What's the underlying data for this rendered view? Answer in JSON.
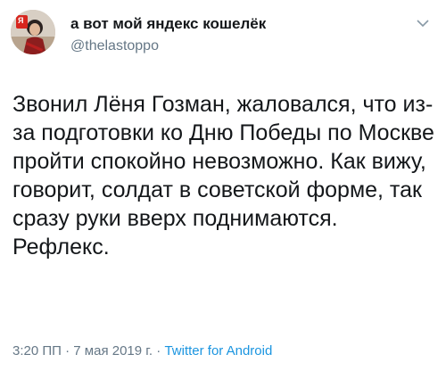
{
  "tweet": {
    "author_name": "а вот мой яндекс кошелёк",
    "author_handle": "@thelastoppo",
    "text": "Звонил Лёня Гозман, жаловался, что из-за подготовки ко Дню Победы по Москве пройти спокойно невозможно. Как вижу, говорит, солдат в советской форме, так сразу руки вверх поднимаются. Рефлекс.",
    "time": "3:20 ПП",
    "separator": " · ",
    "date": "7 мая 2019 г.",
    "source": "Twitter for Android",
    "avatar_badge_text": "Я",
    "link_color": "#1b95e0",
    "muted_color": "#657786"
  }
}
